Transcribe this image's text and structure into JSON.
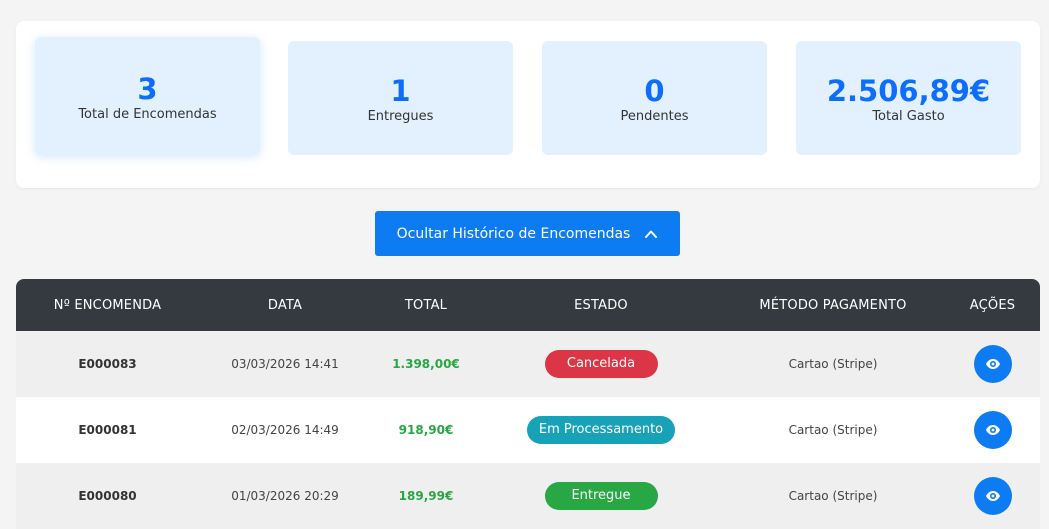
{
  "stats": [
    {
      "value": "3",
      "label": "Total de Encomendas"
    },
    {
      "value": "1",
      "label": "Entregues"
    },
    {
      "value": "0",
      "label": "Pendentes"
    },
    {
      "value": "2.506,89€",
      "label": "Total Gasto"
    }
  ],
  "toggle_button": {
    "label": "Ocultar Histórico de Encomendas",
    "icon": "chevron-up-icon"
  },
  "table": {
    "headers": [
      "Nº ENCOMENDA",
      "DATA",
      "TOTAL",
      "ESTADO",
      "MÉTODO PAGAMENTO",
      "AÇÕES"
    ],
    "rows": [
      {
        "number": "E000083",
        "date": "03/03/2026 14:41",
        "total": "1.398,00€",
        "status": "Cancelada",
        "status_color": "#dc3545",
        "payment": "Cartao (Stripe)",
        "action_icon": "eye-icon"
      },
      {
        "number": "E000081",
        "date": "02/03/2026 14:49",
        "total": "918,90€",
        "status": "Em Processamento",
        "status_color": "#17a2b8",
        "payment": "Cartao (Stripe)",
        "action_icon": "eye-icon"
      },
      {
        "number": "E000080",
        "date": "01/03/2026 20:29",
        "total": "189,99€",
        "status": "Entregue",
        "status_color": "#28a745",
        "payment": "Cartao (Stripe)",
        "action_icon": "eye-icon"
      }
    ]
  },
  "colors": {
    "accent": "#0d7bf2",
    "header_bg": "#343a40",
    "card_bg": "#e3f0fd",
    "total_green": "#28a745"
  }
}
